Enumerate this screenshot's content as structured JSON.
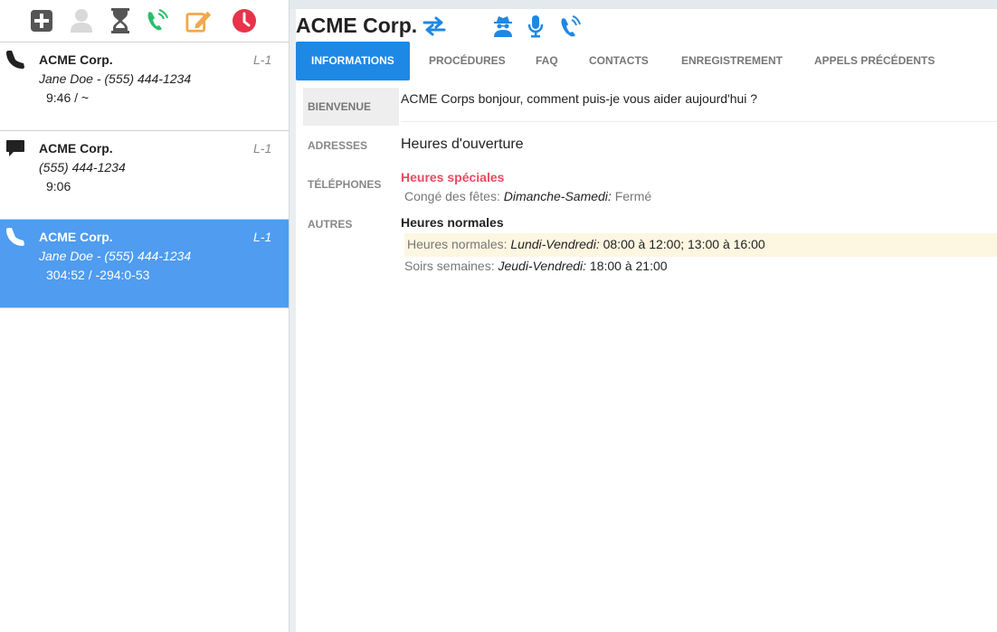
{
  "toolbar": {
    "buttons": [
      {
        "name": "add",
        "icon": "plus-square-icon",
        "color": "#555555"
      },
      {
        "name": "user",
        "icon": "user-icon",
        "color": "#d9d9d9"
      },
      {
        "name": "wait",
        "icon": "hourglass-icon",
        "color": "#555555"
      },
      {
        "name": "call",
        "icon": "phone-volume-icon",
        "color": "#2bbf6a"
      },
      {
        "name": "edit",
        "icon": "edit-icon",
        "color": "#f0a84a"
      },
      {
        "name": "history",
        "icon": "clock-icon",
        "color": "#e8334a"
      }
    ]
  },
  "calls": [
    {
      "icon": "phone-icon",
      "name": "ACME Corp.",
      "line": "L-1",
      "sub": "Jane Doe - (555) 444-1234",
      "time": "9:46 / ~",
      "active": false
    },
    {
      "icon": "comment-icon",
      "name": "ACME Corp.",
      "line": "L-1",
      "sub": "(555) 444-1234",
      "time": "9:06",
      "active": false
    },
    {
      "icon": "phone-icon",
      "name": "ACME Corp.",
      "line": "L-1",
      "sub": "Jane Doe - (555) 444-1234",
      "time": "304:52 / -294:0-53",
      "active": true
    }
  ],
  "header": {
    "company": "ACME Corp.",
    "icons": [
      "transfer-icon",
      "user-secret-icon",
      "microphone-icon",
      "phone-volume-icon"
    ],
    "accent": "#1e88e5"
  },
  "tabs": [
    {
      "label": "INFORMATIONS",
      "active": true
    },
    {
      "label": "PROCÉDURES",
      "active": false
    },
    {
      "label": "FAQ",
      "active": false
    },
    {
      "label": "CONTACTS",
      "active": false
    },
    {
      "label": "ENREGISTREMENT",
      "active": false
    },
    {
      "label": "APPELS PRÉCÉDENTS",
      "active": false
    }
  ],
  "subnav": [
    {
      "label": "BIENVENUE",
      "active": true
    },
    {
      "label": "ADRESSES",
      "active": false
    },
    {
      "label": "TÉLÉPHONES",
      "active": false
    },
    {
      "label": "AUTRES",
      "active": false
    }
  ],
  "content": {
    "welcome": "ACME Corps bonjour, comment puis-je vous aider aujourd'hui ?",
    "hours_title": "Heures d'ouverture",
    "special_title": "Heures spéciales",
    "special_rows": [
      {
        "label": "Congé des fêtes:",
        "days": "Dimanche-Samedi:",
        "value": "Fermé"
      }
    ],
    "normal_title": "Heures normales",
    "normal_rows": [
      {
        "label": "Heures normales:",
        "days": "Lundi-Vendredi:",
        "value": "08:00 à 12:00; 13:00 à 16:00"
      },
      {
        "label": "Soirs semaines:",
        "days": "Jeudi-Vendredi:",
        "value": "18:00 à 21:00"
      }
    ]
  }
}
